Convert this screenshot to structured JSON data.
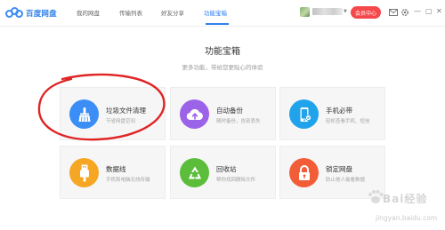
{
  "app": {
    "logo_text": "百度网盘"
  },
  "nav": {
    "tabs": [
      {
        "label": "我的网盘"
      },
      {
        "label": "传输列表"
      },
      {
        "label": "好友分享"
      },
      {
        "label": "功能宝箱"
      }
    ],
    "active_index": 3
  },
  "header": {
    "member_button": "会员中心",
    "icons": [
      "mail-icon",
      "settings-icon"
    ],
    "window_controls": [
      "minimize",
      "restore",
      "close"
    ]
  },
  "main": {
    "title": "功能宝箱",
    "subtitle": "更多功能，带给您更贴心的体验",
    "cards": [
      {
        "title": "垃圾文件清理",
        "desc": "节省网盘空间",
        "icon": "broom-icon",
        "color": "#3a8ef5"
      },
      {
        "title": "自动备份",
        "desc": "随时备份，告别丢失",
        "icon": "cloud-upload-icon",
        "color": "#9b63e8"
      },
      {
        "title": "手机必带",
        "desc": "轻松查看手机、短信",
        "icon": "phone-icon",
        "color": "#21a3eb"
      },
      {
        "title": "数据线",
        "desc": "手机和电脑无线传输",
        "icon": "usb-cable-icon",
        "color": "#f5a623"
      },
      {
        "title": "回收站",
        "desc": "帮你找回删除文件",
        "icon": "recycle-icon",
        "color": "#5bbd3a"
      },
      {
        "title": "锁定网盘",
        "desc": "防止他人偷看数据",
        "icon": "lock-icon",
        "color": "#f25d37"
      }
    ]
  },
  "watermark": {
    "line1": "Bai经验",
    "line2": "jingyan.baidu.com"
  }
}
